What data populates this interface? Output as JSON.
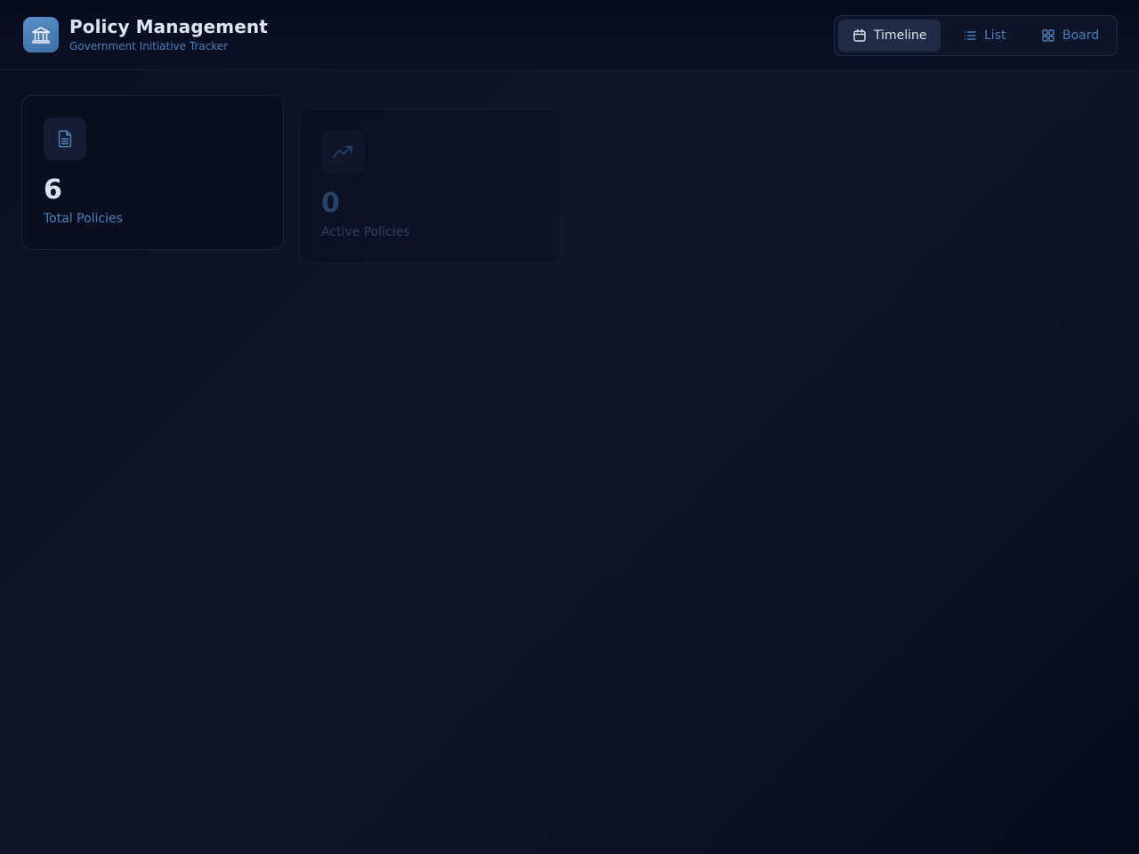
{
  "header": {
    "title": "Policy Management",
    "subtitle": "Government Initiative Tracker",
    "logo_icon": "government-building-icon"
  },
  "view_switch": {
    "active": "Timeline",
    "options": [
      {
        "label": "Timeline",
        "icon": "calendar-icon"
      },
      {
        "label": "List",
        "icon": "list-icon"
      },
      {
        "label": "Board",
        "icon": "grid-icon"
      }
    ]
  },
  "stats": [
    {
      "value": "6",
      "label": "Total Policies",
      "icon": "document-icon"
    },
    {
      "value": "0",
      "label": "Active Policies",
      "icon": "trending-up-icon"
    }
  ],
  "colors": {
    "accent": "#4f7fb8",
    "logo": "#4a7fbb",
    "background": "#0d1324",
    "card": "#0a0f20"
  }
}
